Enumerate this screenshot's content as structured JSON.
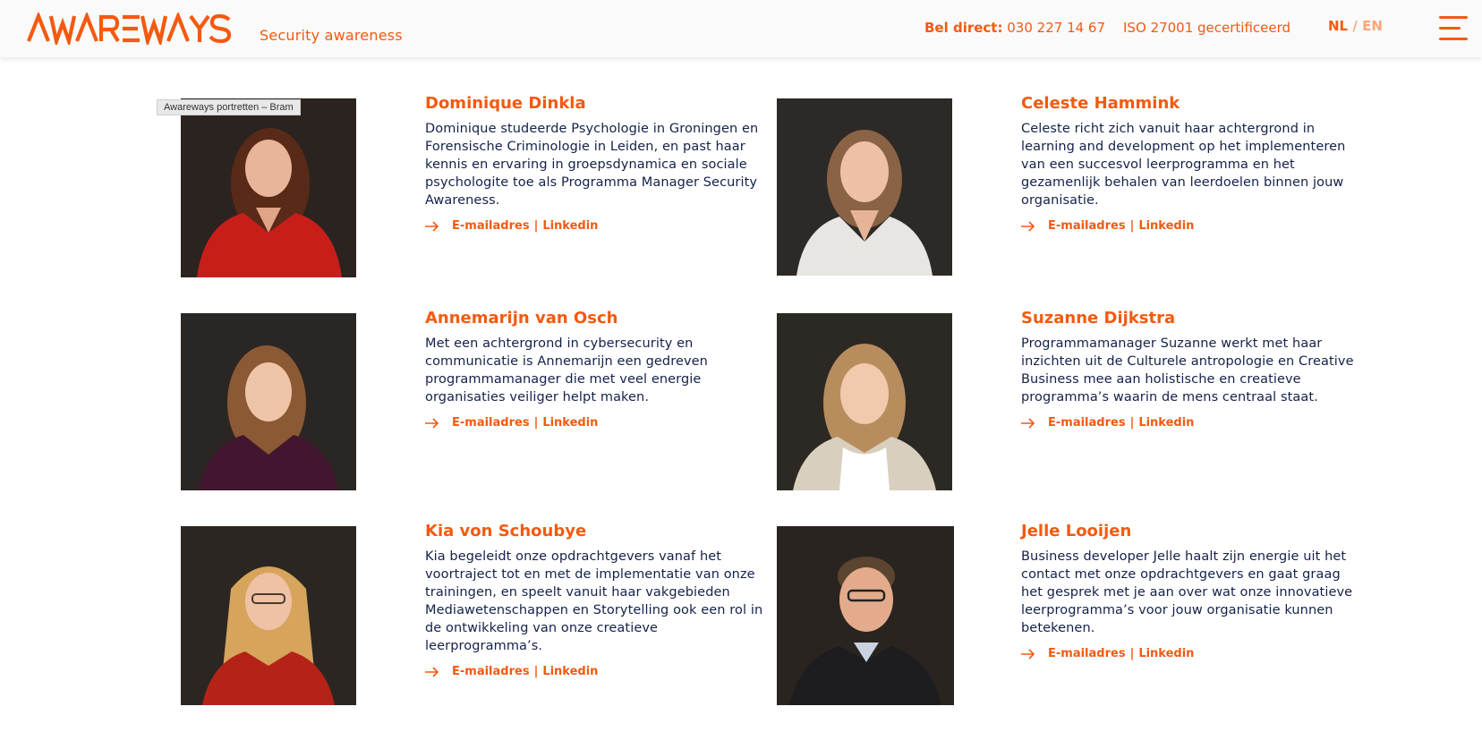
{
  "header": {
    "logo_text": "AWAREWAYS",
    "tagline": "Security awareness",
    "phone_label": "Bel direct:",
    "phone_number": "030 227 14 67",
    "iso": "ISO 27001 gecertificeerd",
    "lang_nl": "NL",
    "lang_sep": "/",
    "lang_en": "EN",
    "brand_color": "#f35a10",
    "menu_icon": "hamburger-menu-icon"
  },
  "tooltip": "Awareways portretten – Bram",
  "members": [
    {
      "name": "Dominique Dinkla",
      "bio": "Dominique studeerde Psychologie in Groningen en Forensische Criminologie in Leiden, en past haar kennis en ervaring in groepsdynamica en sociale psychologite toe als Programma Manager Security Awareness.",
      "email_label": "E-mailadres",
      "sep": "|",
      "linkedin_label": "Linkedin"
    },
    {
      "name": "Celeste Hammink",
      "bio": "Celeste richt zich vanuit haar achtergrond in learning and development op het implementeren van een succesvol leerprogramma en het gezamenlijk behalen van leerdoelen binnen jouw organisatie.",
      "email_label": "E-mailadres",
      "sep": "|",
      "linkedin_label": "Linkedin"
    },
    {
      "name": "Annemarijn van Osch",
      "bio": "Met een achtergrond in cybersecurity en communicatie is Annemarijn een gedreven programmamanager die met veel energie organisaties veiliger helpt maken.",
      "email_label": "E-mailadres",
      "sep": "|",
      "linkedin_label": "Linkedin"
    },
    {
      "name": "Suzanne Dijkstra",
      "bio": "Programmamanager Suzanne werkt met haar inzichten uit de Culturele antropologie en Creative Business mee aan holistische en creatieve programma’s waarin de mens centraal staat.",
      "email_label": "E-mailadres",
      "sep": "|",
      "linkedin_label": "Linkedin"
    },
    {
      "name": "Kia von Schoubye",
      "bio": "Kia begeleidt onze opdrachtgevers vanaf het voortraject tot en met de implementatie van onze trainingen, en speelt vanuit haar vakgebieden Mediawetenschappen en Storytelling ook een rol in de ontwikkeling van onze creatieve leerprogramma’s.",
      "email_label": "E-mailadres",
      "sep": "|",
      "linkedin_label": "Linkedin"
    },
    {
      "name": "Jelle Looijen",
      "bio": "Business developer Jelle haalt zijn energie uit het contact met onze opdrachtgevers en gaat graag het gesprek met je aan over wat onze innovatieve leerprogramma’s voor jouw organisatie kunnen betekenen.",
      "email_label": "E-mailadres",
      "sep": "|",
      "linkedin_label": "Linkedin"
    }
  ]
}
